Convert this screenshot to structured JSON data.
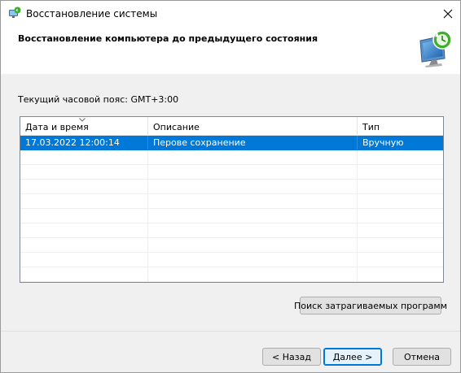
{
  "window": {
    "title": "Восстановление системы",
    "close_glyph": "✕"
  },
  "header": {
    "title": "Восстановление компьютера до предыдущего состояния",
    "icon": "system-restore-monitor-icon"
  },
  "timezone": {
    "label": "Текущий часовой пояс: GMT+3:00"
  },
  "table": {
    "columns": [
      "Дата и время",
      "Описание",
      "Тип"
    ],
    "sorted_column": "Дата и время",
    "rows": [
      {
        "date": "17.03.2022 12:00:14",
        "description": "Перове сохранение",
        "type": "Вручную",
        "selected": true
      }
    ]
  },
  "buttons": {
    "scan": "Поиск затрагиваемых программ",
    "back": "< Назад",
    "next": "Далее >",
    "cancel": "Отмена"
  },
  "colors": {
    "selection": "#0078d7",
    "content_bg": "#f0f0f0",
    "accent_green": "#3fae2a"
  }
}
